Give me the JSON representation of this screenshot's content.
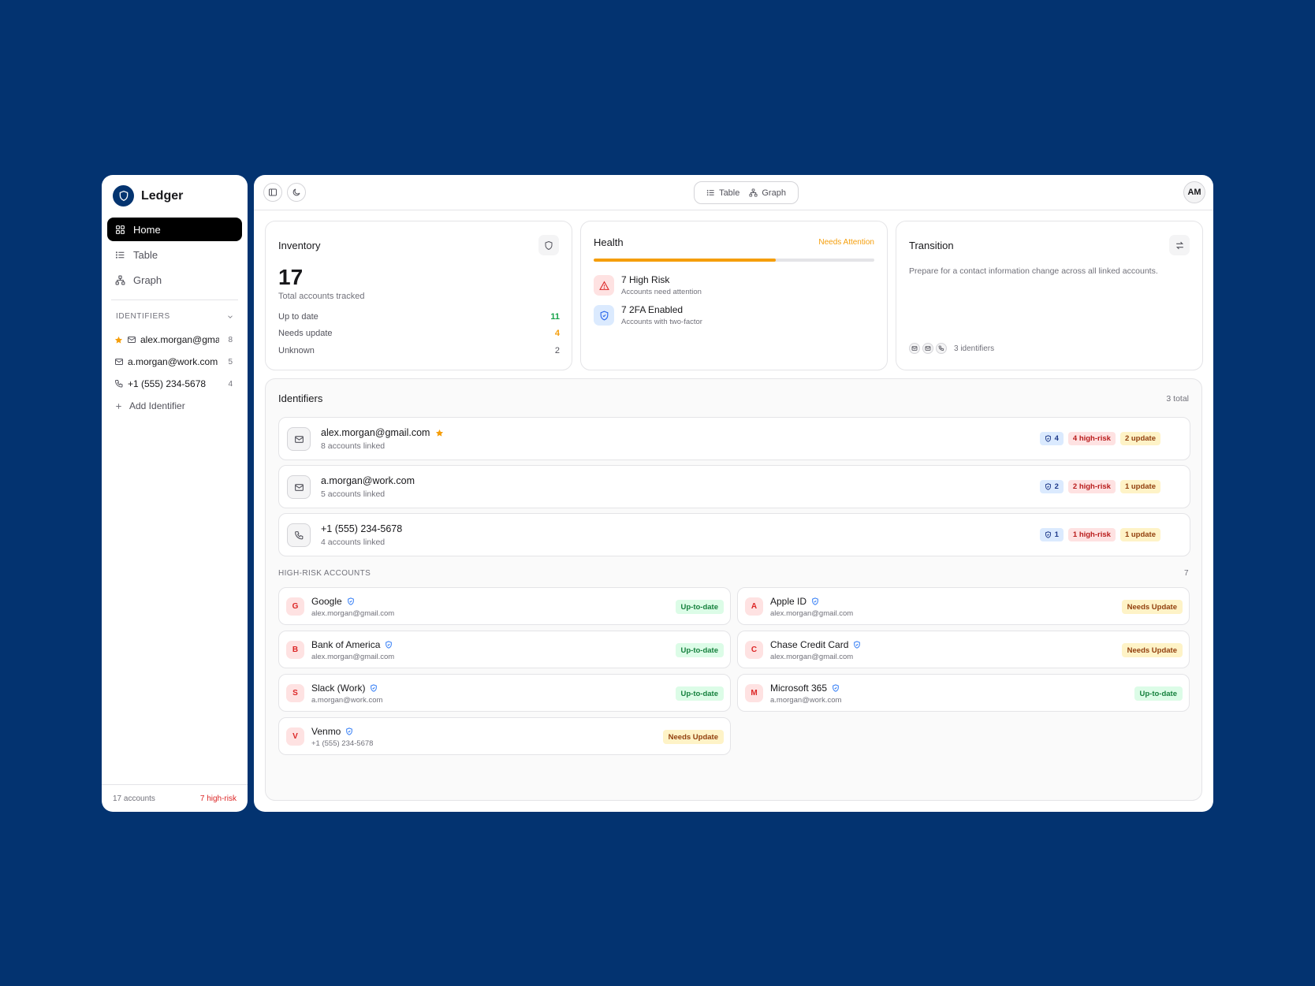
{
  "brand": {
    "name": "Ledger"
  },
  "nav": [
    {
      "label": "Home",
      "icon": "grid-icon",
      "active": true
    },
    {
      "label": "Table",
      "icon": "list-icon",
      "active": false
    },
    {
      "label": "Graph",
      "icon": "graph-icon",
      "active": false
    }
  ],
  "sidebar": {
    "identifiers_heading": "IDENTIFIERS",
    "identifiers": [
      {
        "text": "alex.morgan@gmail.com",
        "count": "8",
        "type": "email",
        "starred": true
      },
      {
        "text": "a.morgan@work.com",
        "count": "5",
        "type": "email",
        "starred": false
      },
      {
        "text": "+1 (555) 234-5678",
        "count": "4",
        "type": "phone",
        "starred": false
      }
    ],
    "add_label": "Add Identifier",
    "footer_accounts": "17 accounts",
    "footer_risk": "7 high-risk"
  },
  "topbar": {
    "toggle_table": "Table",
    "toggle_graph": "Graph",
    "avatar": "AM"
  },
  "inventory": {
    "title": "Inventory",
    "total": "17",
    "subtitle": "Total accounts tracked",
    "rows": [
      {
        "label": "Up to date",
        "value": "11",
        "color": "#16a34a"
      },
      {
        "label": "Needs update",
        "value": "4",
        "color": "#f59e0b"
      },
      {
        "label": "Unknown",
        "value": "2",
        "color": "#52525b"
      }
    ]
  },
  "health": {
    "title": "Health",
    "status": "Needs Attention",
    "progress_fraction": 0.65,
    "items": [
      {
        "title": "7 High Risk",
        "sub": "Accounts need attention"
      },
      {
        "title": "7 2FA Enabled",
        "sub": "Accounts with two-factor"
      }
    ]
  },
  "transition": {
    "title": "Transition",
    "description": "Prepare for a contact information change across all linked accounts.",
    "footer": "3 identifiers"
  },
  "identifiers_panel": {
    "title": "Identifiers",
    "count": "3 total",
    "items": [
      {
        "name": "alex.morgan@gmail.com",
        "sub": "8 accounts linked",
        "type": "email",
        "starred": true,
        "twofa": "4",
        "high_risk": "4 high-risk",
        "update": "2 update"
      },
      {
        "name": "a.morgan@work.com",
        "sub": "5 accounts linked",
        "type": "email",
        "starred": false,
        "twofa": "2",
        "high_risk": "2 high-risk",
        "update": "1 update"
      },
      {
        "name": "+1 (555) 234-5678",
        "sub": "4 accounts linked",
        "type": "phone",
        "starred": false,
        "twofa": "1",
        "high_risk": "1 high-risk",
        "update": "1 update"
      }
    ]
  },
  "high_risk": {
    "heading": "HIGH-RISK ACCOUNTS",
    "count": "7",
    "accounts": [
      {
        "initial": "G",
        "name": "Google",
        "sub": "alex.morgan@gmail.com",
        "status": "Up-to-date"
      },
      {
        "initial": "A",
        "name": "Apple ID",
        "sub": "alex.morgan@gmail.com",
        "status": "Needs Update"
      },
      {
        "initial": "B",
        "name": "Bank of America",
        "sub": "alex.morgan@gmail.com",
        "status": "Up-to-date"
      },
      {
        "initial": "C",
        "name": "Chase Credit Card",
        "sub": "alex.morgan@gmail.com",
        "status": "Needs Update"
      },
      {
        "initial": "S",
        "name": "Slack (Work)",
        "sub": "a.morgan@work.com",
        "status": "Up-to-date"
      },
      {
        "initial": "M",
        "name": "Microsoft 365",
        "sub": "a.morgan@work.com",
        "status": "Up-to-date"
      },
      {
        "initial": "V",
        "name": "Venmo",
        "sub": "+1 (555) 234-5678",
        "status": "Needs Update"
      }
    ]
  },
  "colors": {
    "background": "#033370",
    "accent": "#f59e0b",
    "danger": "#dc2626",
    "success": "#16a34a"
  }
}
